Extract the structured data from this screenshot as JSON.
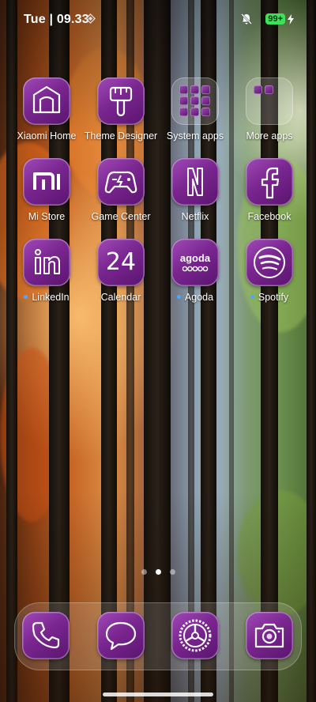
{
  "status_bar": {
    "time": "Tue | 09.33",
    "battery": "99+"
  },
  "apps": [
    {
      "label": "Xiaomi Home",
      "icon": "xiaomi-home-icon"
    },
    {
      "label": "Theme Designer",
      "icon": "paintbrush-icon"
    },
    {
      "label": "System apps",
      "icon": "folder-icon"
    },
    {
      "label": "More apps",
      "icon": "folder-icon"
    },
    {
      "label": "Mi Store",
      "icon": "mi-logo-icon"
    },
    {
      "label": "Game Center",
      "icon": "gamepad-icon"
    },
    {
      "label": "Netflix",
      "icon": "netflix-logo-icon"
    },
    {
      "label": "Facebook",
      "icon": "facebook-logo-icon"
    },
    {
      "label": "LinkedIn",
      "icon": "linkedin-logo-icon"
    },
    {
      "label": "Calendar",
      "icon": "calendar-icon",
      "text": "24"
    },
    {
      "label": "Agoda",
      "icon": "agoda-logo-icon",
      "text": "agoda"
    },
    {
      "label": "Spotify",
      "icon": "spotify-logo-icon"
    }
  ],
  "dock": [
    {
      "name": "Phone",
      "icon": "phone-icon"
    },
    {
      "name": "Messages",
      "icon": "chat-bubble-icon"
    },
    {
      "name": "Settings",
      "icon": "gear-icon"
    },
    {
      "name": "Camera",
      "icon": "camera-icon"
    }
  ],
  "page_indicator": {
    "pages": 3,
    "current": 2
  },
  "colors": {
    "icon_purple": "#7a2690",
    "battery_green": "#3fe05a",
    "new_dot_blue": "#4aa8ff"
  }
}
